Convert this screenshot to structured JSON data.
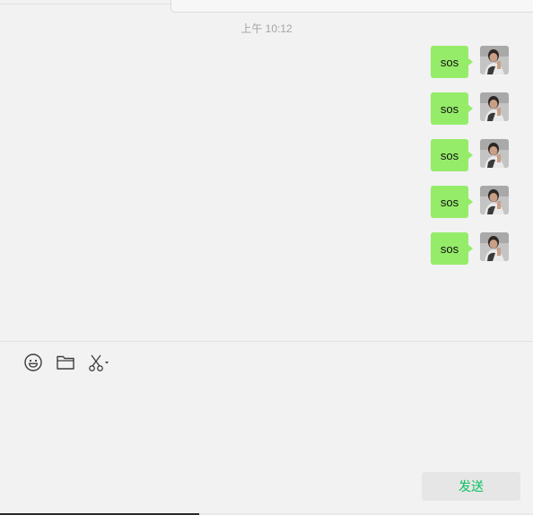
{
  "chat": {
    "timestamp": "上午 10:12",
    "messages": [
      {
        "text": "sos",
        "sender": "self"
      },
      {
        "text": "sos",
        "sender": "self"
      },
      {
        "text": "sos",
        "sender": "self"
      },
      {
        "text": "sos",
        "sender": "self"
      },
      {
        "text": "sos",
        "sender": "self"
      }
    ]
  },
  "input_toolbar": {
    "tools": [
      {
        "icon": "emoji-icon"
      },
      {
        "icon": "folder-icon"
      },
      {
        "icon": "scissors-icon"
      }
    ]
  },
  "composer": {
    "send_label": "发送"
  },
  "colors": {
    "background": "#f2f2f2",
    "bubble_self": "#95ec69",
    "send_text": "#07c160",
    "send_bg": "#e6e6e6"
  }
}
